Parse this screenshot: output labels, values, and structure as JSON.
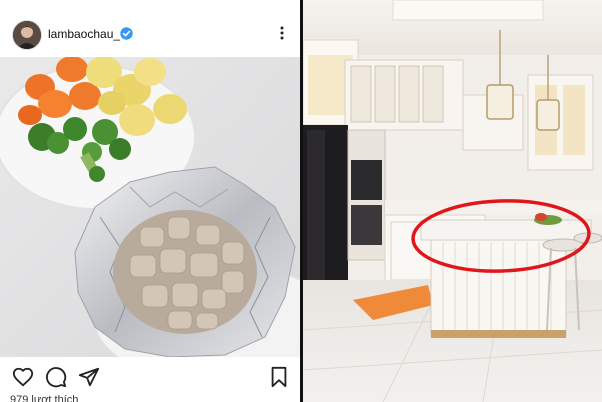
{
  "post": {
    "username": "lambaochau_",
    "likes_text": "979 lượt thích"
  },
  "icons": {
    "avatar": "avatar",
    "verified": "verified-badge-icon",
    "more": "more-options-icon",
    "like": "heart-icon",
    "comment": "comment-icon",
    "share": "send-icon",
    "save": "bookmark-icon"
  },
  "colors": {
    "verified_blue": "#3897f0",
    "highlight_red": "#e0161b"
  }
}
